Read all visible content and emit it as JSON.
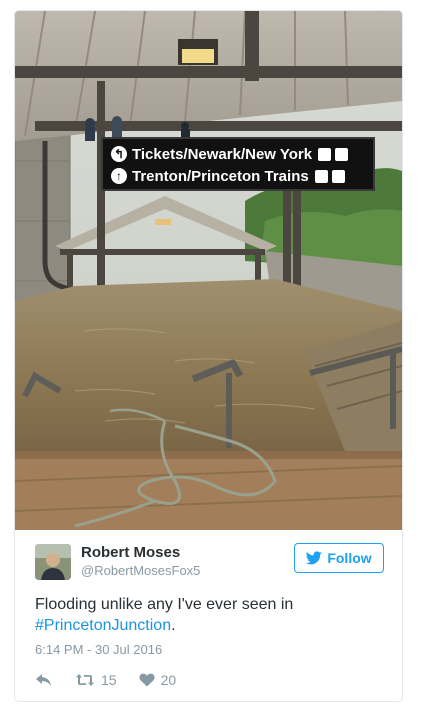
{
  "photo": {
    "sign": {
      "line1": "Tickets/Newark/New York",
      "line2": "Trenton/Princeton Trains"
    }
  },
  "author": {
    "name": "Robert Moses",
    "handle": "@RobertMosesFox5"
  },
  "follow_button": {
    "label": "Follow",
    "icon": "twitter-bird-icon"
  },
  "tweet": {
    "text_line1": "Flooding unlike any I've ever seen in",
    "hashtag": "#PrincetonJunction",
    "hashtag_suffix": ".",
    "timestamp": "6:14 PM - 30 Jul 2016"
  },
  "actions": {
    "reply": {
      "icon": "reply-icon"
    },
    "retweet": {
      "icon": "retweet-icon",
      "count": "15"
    },
    "like": {
      "icon": "heart-icon",
      "count": "20"
    }
  },
  "colors": {
    "brand_blue": "#1da1f2",
    "link_blue": "#1b95e0",
    "muted": "#8899a6",
    "text": "#292f33",
    "border": "#e1e8ed"
  }
}
